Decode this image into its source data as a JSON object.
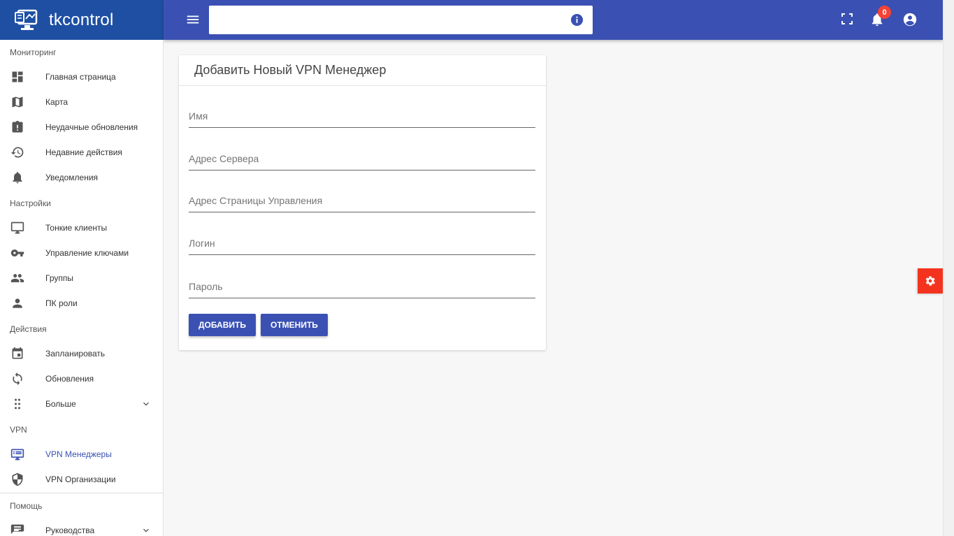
{
  "app": {
    "name": "tkcontrol"
  },
  "topbar": {
    "search_value": "",
    "notifications_count": "0"
  },
  "sidebar": {
    "sections": [
      {
        "title": "Мониторинг"
      },
      {
        "title": "Настройки"
      },
      {
        "title": "Действия"
      },
      {
        "title": "VPN"
      },
      {
        "title": "Помощь"
      }
    ],
    "items": [
      {
        "label": "Главная страница",
        "icon": "dashboard-icon"
      },
      {
        "label": "Карта",
        "icon": "map-icon"
      },
      {
        "label": "Неудачные обновления",
        "icon": "clipboard-alert-icon"
      },
      {
        "label": "Недавние действия",
        "icon": "history-icon"
      },
      {
        "label": "Уведомления",
        "icon": "bell-icon"
      },
      {
        "label": "Тонкие клиенты",
        "icon": "monitor-icon"
      },
      {
        "label": "Управление ключами",
        "icon": "key-icon"
      },
      {
        "label": "Группы",
        "icon": "people-icon"
      },
      {
        "label": "ПК роли",
        "icon": "person-icon"
      },
      {
        "label": "Запланировать",
        "icon": "calendar-icon"
      },
      {
        "label": "Обновления",
        "icon": "refresh-icon"
      },
      {
        "label": "Больше",
        "icon": "dots-grid-icon"
      },
      {
        "label": "VPN Менеджеры",
        "icon": "vpn-manager-icon"
      },
      {
        "label": "VPN Организации",
        "icon": "shield-icon"
      },
      {
        "label": "Руководства",
        "icon": "guide-icon"
      }
    ]
  },
  "form": {
    "title": "Добавить Новый VPN Менеджер",
    "fields": [
      {
        "placeholder": "Имя",
        "value": ""
      },
      {
        "placeholder": "Адрес Сервера",
        "value": ""
      },
      {
        "placeholder": "Адрес Страницы Управления",
        "value": ""
      },
      {
        "placeholder": "Логин",
        "value": ""
      },
      {
        "placeholder": "Пароль",
        "value": ""
      }
    ],
    "add_label": "ДОБАВИТЬ",
    "cancel_label": "ОТМЕНИТЬ"
  },
  "colors": {
    "header": "#3a51b3",
    "brand": "#1e4fa3",
    "accent": "#3a51b3",
    "settings": "#f4331f",
    "badge": "#f44336"
  }
}
